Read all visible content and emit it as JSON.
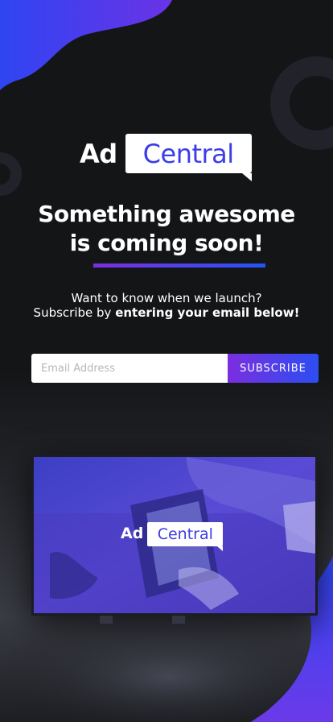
{
  "logo": {
    "ad": "Ad",
    "central": "Central"
  },
  "headline": {
    "line1": "Something awesome",
    "line2": "is coming soon!"
  },
  "subtext": {
    "line1": "Want to know when we launch?",
    "line2_prefix": "Subscribe by ",
    "line2_bold": "entering your email below!"
  },
  "form": {
    "email_placeholder": "Email Address",
    "email_value": "",
    "subscribe_label": "SUBSCRIBE"
  },
  "tv_logo": {
    "ad": "Ad",
    "central": "Central"
  },
  "colors": {
    "background": "#141517",
    "accent_purple": "#7b2ee0",
    "accent_blue": "#2b4ef2",
    "logo_text": "#3b3de6"
  },
  "icons": [
    "logo-speech-bubble",
    "decorative-blob",
    "decorative-ring"
  ]
}
